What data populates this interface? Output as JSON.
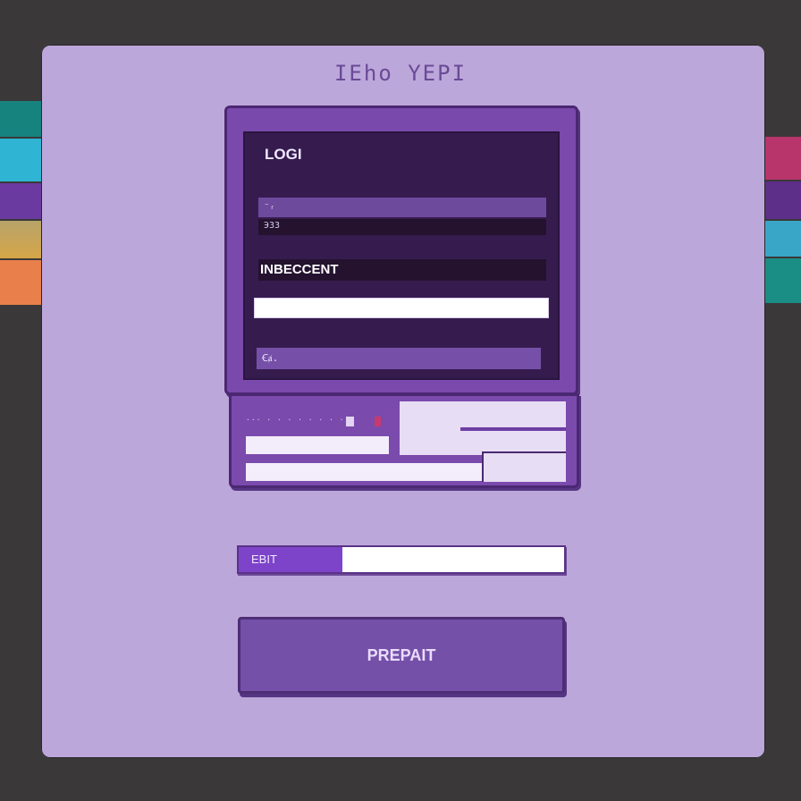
{
  "header": {
    "title": "IEho YEPI"
  },
  "screen": {
    "title": "LOGI",
    "field1_value": "⁻ᵣ",
    "field1_hint": "ЭЗЗ",
    "section_label": "INBECCENT",
    "field2_value": "",
    "field3_value": "Ꞓⱥ."
  },
  "base_unit": {
    "dots_text": "··· · · · · · · · · ·"
  },
  "progress": {
    "label": "EBIT",
    "percent": 32
  },
  "button": {
    "label": "PREPAIT"
  },
  "colors": {
    "background": "#3a3838",
    "panel": "#bca7da",
    "monitor": "#7a49ac",
    "screen": "#361c4e",
    "accent": "#7d44c9",
    "button": "#7450a9"
  },
  "side_tabs": {
    "left": [
      "#17837f",
      "#2fb5d3",
      "#6b3aa0",
      "#d6a648",
      "#e9804c"
    ],
    "right": [
      "#b8356b",
      "#5d2f88",
      "#3aa6c7",
      "#1a8d84"
    ]
  }
}
